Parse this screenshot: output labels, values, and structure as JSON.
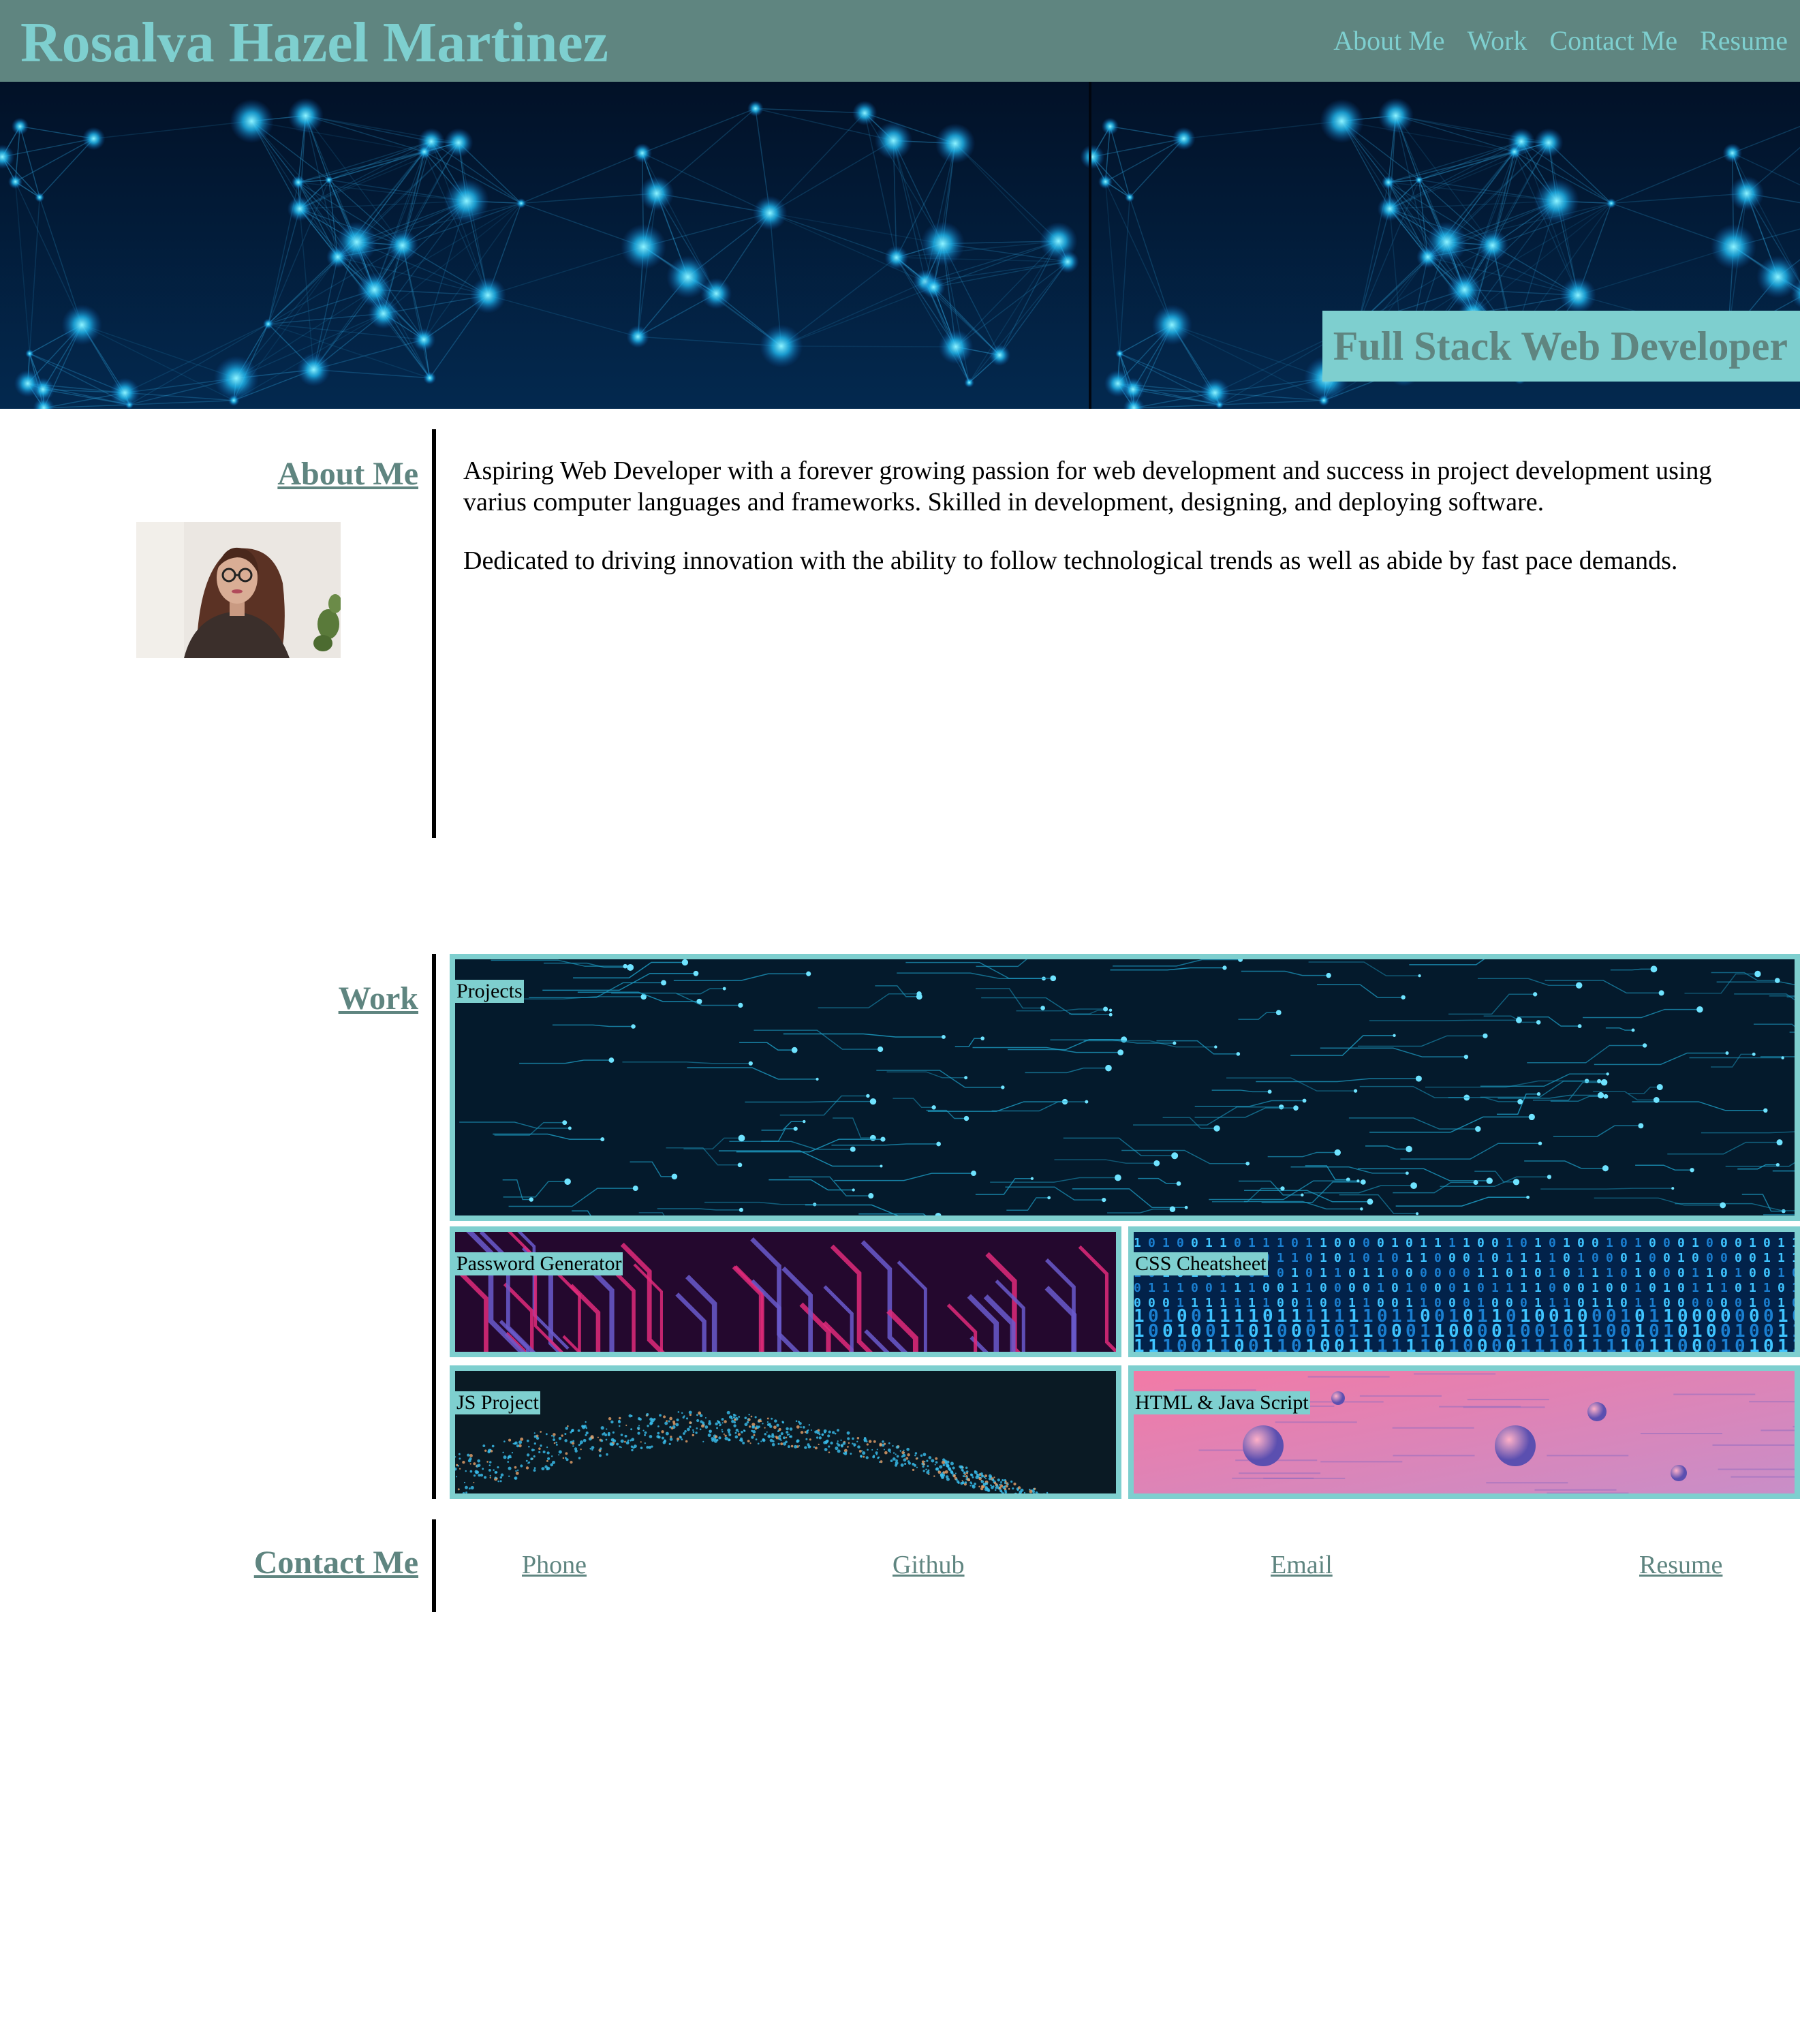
{
  "header": {
    "name": "Rosalva Hazel Martinez",
    "nav": [
      "About Me",
      "Work",
      "Contact Me",
      "Resume"
    ]
  },
  "hero": {
    "tagline": "Full Stack Web Developer"
  },
  "about": {
    "heading": "About Me",
    "paragraphs": [
      "Aspiring Web Developer with a forever growing passion for web development and success in project development using varius computer languages and frameworks. Skilled in development, designing, and deploying software.",
      "Dedicated to driving innovation with the ability to follow technological trends as well as abide by fast pace demands."
    ]
  },
  "work": {
    "heading": "Work",
    "tiles": [
      "Projects",
      "Password Generator",
      "CSS Cheatsheet",
      "JS Project",
      "HTML & Java Script"
    ]
  },
  "contact": {
    "heading": "Contact Me",
    "links": [
      "Phone",
      "Github",
      "Email",
      "Resume"
    ]
  },
  "colors": {
    "header_bg": "#5f8580",
    "accent": "#7ecfcf"
  }
}
